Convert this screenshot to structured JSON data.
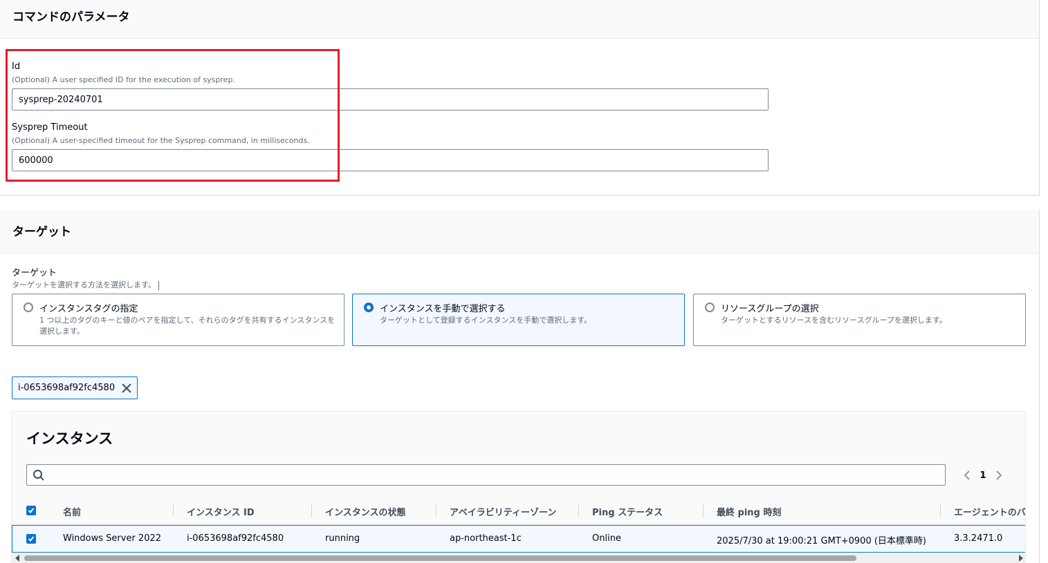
{
  "params_section": {
    "title": "コマンドのパラメータ",
    "id_field": {
      "label": "Id",
      "description": "(Optional) A user specified ID for the execution of sysprep.",
      "value": "sysprep-20240701"
    },
    "timeout_field": {
      "label": "Sysprep Timeout",
      "description": "(Optional) A user-specified timeout for the Sysprep command, in milliseconds.",
      "value": "600000"
    },
    "highlight_color": "#e21d2b"
  },
  "target_section": {
    "title": "ターゲット",
    "field_label": "ターゲット",
    "field_description": "ターゲットを選択する方法を選択します。",
    "options": [
      {
        "title": "インスタンスタグの指定",
        "description": "1 つ以上のタグのキーと値のペアを指定して、それらのタグを共有するインスタンスを選択します。",
        "selected": false
      },
      {
        "title": "インスタンスを手動で選択する",
        "description": "ターゲットとして登録するインスタンスを手動で選択します。",
        "selected": true
      },
      {
        "title": "リソースグループの選択",
        "description": "ターゲットとするリソースを含むリソースグループを選択します。",
        "selected": false
      }
    ],
    "selected_token": "i-0653698af92fc4580",
    "accent_color": "#0972d3"
  },
  "instances_table": {
    "title": "インスタンス",
    "search_value": "",
    "current_page": "1",
    "columns": [
      "名前",
      "インスタンス ID",
      "インスタンスの状態",
      "アベイラビリティーゾーン",
      "Ping ステータス",
      "最終 ping 時刻",
      "エージェントのバ"
    ],
    "rows": [
      {
        "selected": true,
        "cells": [
          "Windows Server 2022",
          "i-0653698af92fc4580",
          "running",
          "ap-northeast-1c",
          "Online",
          "2025/7/30 at 19:00:21 GMT+0900 (日本標準時)",
          "3.3.2471.0"
        ]
      }
    ]
  }
}
